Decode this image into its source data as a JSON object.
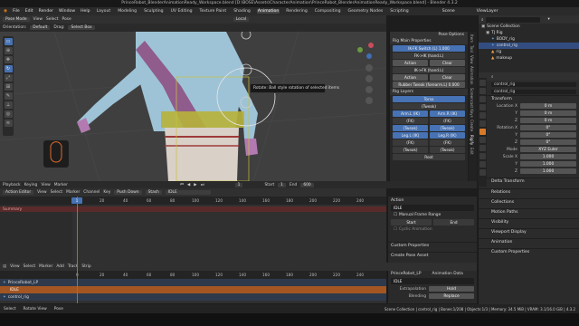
{
  "window": {
    "title": "PrinceRobot_BlenderAnimationReady_Workspace.blend [D:\\BOSE\\Assets\\CharacterAnimation\\PrinceRobot_BlenderAnimationReady_Workspace.blend] - Blender 4.3.2"
  },
  "menu": {
    "items": [
      "File",
      "Edit",
      "Render",
      "Window",
      "Help"
    ],
    "workspaces": [
      "Layout",
      "Modeling",
      "Sculpting",
      "UV Editing",
      "Texture Paint",
      "Shading",
      "Animation",
      "Rendering",
      "Compositing",
      "Geometry Nodes",
      "Scripting"
    ],
    "active_workspace": "Animation",
    "scene": "Scene",
    "view_layer": "ViewLayer"
  },
  "viewport_header": {
    "mode": "Pose Mode",
    "view": "View",
    "select": "Select",
    "pose": "Pose",
    "transform": "Local"
  },
  "viewport_header2": {
    "orientation_label": "Orientation:",
    "orientation": "Default",
    "drag_label": "Drag:",
    "drag": "Select Box",
    "options": "Options"
  },
  "tooltip": {
    "text": "Rotate: Ball style rotation of selected items"
  },
  "npanel": {
    "section1": "Rig Main Properties",
    "fields1": [
      "IK-FK Switch (L)  1.000",
      "FK->IK (hand.L)"
    ],
    "action": "Action",
    "clear": "Clear",
    "fields2": [
      "IK->FK (hand.L)"
    ],
    "rubber": "Rubber Tweak (forearm.L)  0.000",
    "section2": "Rig Layers",
    "layers": [
      [
        "Torso"
      ],
      [
        "(Tweak)"
      ],
      [
        "Arm.L (IK)",
        "Arm.R (IK)"
      ],
      [
        "(FK)",
        "(FK)"
      ],
      [
        "(Tweak)",
        "(Tweak)"
      ],
      [
        "Leg.L (IK)",
        "Leg.R (IK)"
      ],
      [
        "(FK)",
        "(FK)"
      ],
      [
        "(Tweak)",
        "(Tweak)"
      ],
      [
        "Root"
      ]
    ],
    "pose_options": "Pose Options"
  },
  "ntabs": [
    "Item",
    "Tool",
    "View",
    "Animation",
    "Screencast Keys",
    "Create",
    "Rigify",
    "Edit"
  ],
  "outliner": {
    "search": "",
    "rows": [
      {
        "label": "Scene Collection",
        "indent": 0,
        "sel": false
      },
      {
        "label": "TJ Rig",
        "indent": 1,
        "sel": false
      },
      {
        "label": "BODY_rig",
        "indent": 2,
        "sel": false
      },
      {
        "label": "control_rig",
        "indent": 2,
        "sel": true
      },
      {
        "label": "rig",
        "indent": 2,
        "sel": false
      },
      {
        "label": "makeup",
        "indent": 2,
        "sel": false
      }
    ]
  },
  "properties": {
    "object_name": "control_rig",
    "data_name": "control_rig",
    "transform": "Transform",
    "location_label": "Location X",
    "loc": [
      "0 m",
      "0 m",
      "0 m"
    ],
    "rotation_label": "Rotation X",
    "rot": [
      "0°",
      "0°",
      "0°"
    ],
    "mode_label": "Mode",
    "mode": "XYZ Euler",
    "scale_label": "Scale X",
    "scale": [
      "1.000",
      "1.000",
      "1.000"
    ],
    "axis_y": "Y",
    "axis_z": "Z",
    "sections": [
      "Delta Transform",
      "Relations",
      "Collections",
      "Motion Paths",
      "Visibility",
      "Viewport Display",
      "Animation",
      "Custom Properties"
    ]
  },
  "playback": {
    "items": [
      "Playback",
      "Keying",
      "View",
      "Marker"
    ],
    "frame": "1",
    "start_label": "Start",
    "start": "1",
    "end_label": "End",
    "end": "600"
  },
  "dope": {
    "editor": "Action Editor",
    "view": "View",
    "select": "Select",
    "marker": "Marker",
    "channel": "Channel",
    "key": "Key",
    "push_down": "Push Down",
    "stash": "Stash",
    "action": "IDLE",
    "summary": "Summary",
    "ruler": [
      "0",
      "20",
      "40",
      "60",
      "80",
      "100",
      "120",
      "140",
      "160",
      "180",
      "200",
      "220",
      "240"
    ],
    "current": "1"
  },
  "action_panel": {
    "title": "Action",
    "action_name": "IDLE",
    "manual_range": "Manual Frame Range",
    "start": "Start",
    "end": "End",
    "cyclic": "Cyclic Animation",
    "custom": "Custom Properties",
    "create": "Create Pose Asset"
  },
  "nla": {
    "items": [
      "View",
      "Select",
      "Marker",
      "Add",
      "Track",
      "Strip"
    ],
    "rows": [
      {
        "label": "PrinceRobot_LP"
      },
      {
        "label": "IDLE"
      },
      {
        "label": "control_rig"
      }
    ],
    "side": {
      "obj": "PrinceRobot_LP",
      "anim": "Animation Data",
      "action": "IDLE",
      "extrap_label": "Extrapolation",
      "extrap": "Hold",
      "blend_label": "Blending",
      "blend": "Replace"
    }
  },
  "status": {
    "items": [
      "Select",
      "Rotate View",
      "Pose"
    ],
    "info": "Scene Collection | control_rig | Bones:1/208 | Objects:1/3 | Memory: 34.5 MiB | VRAM: 3.1/16.0 GiB | 4.3.2"
  },
  "colors": {
    "accent": "#4772b3",
    "orange": "#d87a2a",
    "selected_row": "#334d80"
  }
}
